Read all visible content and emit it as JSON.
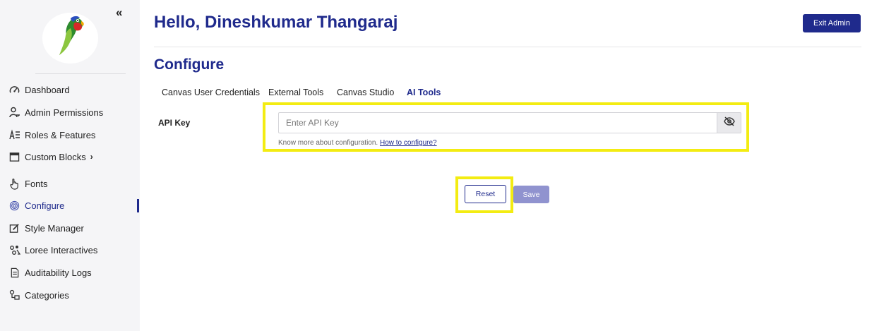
{
  "sidebar": {
    "collapse_icon": "double-chevron-left-icon",
    "logo_icon": "parrot-logo",
    "items": [
      {
        "label": "Dashboard",
        "icon": "speedometer-icon"
      },
      {
        "label": "Admin Permissions",
        "icon": "user-key-icon"
      },
      {
        "label": "Roles & Features",
        "icon": "roles-features-icon"
      },
      {
        "label": "Custom Blocks",
        "icon": "blocks-icon",
        "chevron": "›"
      },
      {
        "label": "Fonts",
        "icon": "hand-pointer-icon"
      },
      {
        "label": "Configure",
        "icon": "fingerprint-icon",
        "active": true
      },
      {
        "label": "Style Manager",
        "icon": "edit-square-icon"
      },
      {
        "label": "Loree Interactives",
        "icon": "interactives-icon"
      },
      {
        "label": "Auditability Logs",
        "icon": "log-document-icon"
      },
      {
        "label": "Categories",
        "icon": "categories-icon"
      }
    ]
  },
  "header": {
    "greeting": "Hello, Dineshkumar Thangaraj",
    "exit_label": "Exit Admin"
  },
  "main": {
    "section_title": "Configure",
    "tabs": [
      {
        "label": "Canvas User Credentials"
      },
      {
        "label": "External Tools"
      },
      {
        "label": "Canvas Studio"
      },
      {
        "label": "AI Tools",
        "active": true
      }
    ],
    "api_key": {
      "label": "API Key",
      "value": "",
      "placeholder": "Enter API Key",
      "toggle_icon": "eye-slash-icon",
      "help_text": "Know more about configuration.",
      "help_link": "How to configure?"
    },
    "reset_label": "Reset",
    "save_label": "Save"
  },
  "colors": {
    "brand": "#1f2a8c",
    "highlight": "#f3ec12",
    "save_disabled": "#9093cf",
    "sidebar_bg": "#f5f5f7"
  }
}
